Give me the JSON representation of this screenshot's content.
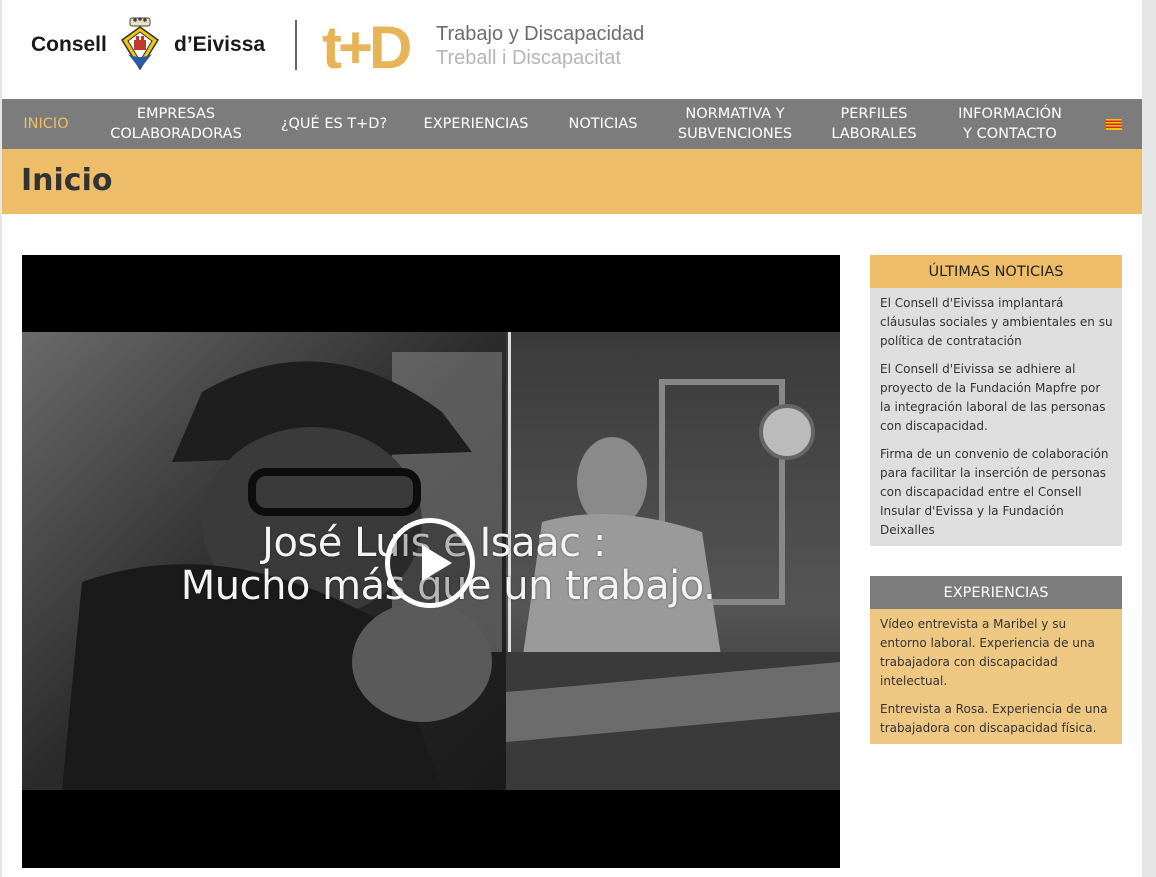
{
  "header": {
    "consell_left": "Consell",
    "consell_right": "d’Eivissa",
    "td_logo": "t+D",
    "td_line1": "Trabajo y Discapacidad",
    "td_line2": "Treball i Discapacitat"
  },
  "nav": {
    "items": [
      {
        "label": "INICIO",
        "active": true
      },
      {
        "label": "EMPRESAS\nCOLABORADORAS"
      },
      {
        "label": "¿QUÉ ES T+D?"
      },
      {
        "label": "EXPERIENCIAS"
      },
      {
        "label": "NOTICIAS"
      },
      {
        "label": "NORMATIVA Y\nSUBVENCIONES"
      },
      {
        "label": "PERFILES\nLABORALES"
      },
      {
        "label": "INFORMACIÓN\nY CONTACTO"
      }
    ],
    "flag_icon": "catalan-flag-icon"
  },
  "page": {
    "title": "Inicio"
  },
  "video": {
    "overlay_line1": "José Luis e Isaac :",
    "overlay_line2": "Mucho más que un trabajo."
  },
  "news": {
    "heading": "ÚLTIMAS NOTICIAS",
    "items": [
      "El Consell d'Eivissa implantará cláusulas sociales y ambientales en su política de contratación",
      "El Consell d'Eivissa se adhiere al proyecto de la Fundación Mapfre por la integración laboral de las personas con discapacidad.",
      "Firma de un convenio de colaboración para facilitar la inserción de personas con discapacidad entre el Consell Insular d'Evissa y la Fundación Deixalles"
    ]
  },
  "experiences": {
    "heading": "EXPERIENCIAS",
    "items": [
      "Vídeo entrevista a Maribel y su entorno laboral. Experiencia de una trabajadora con discapacidad intelectual.",
      "Entrevista a Rosa. Experiencia de una trabajadora con discapacidad física."
    ]
  },
  "colors": {
    "nav_bg": "#7c7c7c",
    "accent": "#eebd6a",
    "active_nav": "#eebd63",
    "news_bg": "#dedede",
    "exp_bg": "#eec882"
  }
}
